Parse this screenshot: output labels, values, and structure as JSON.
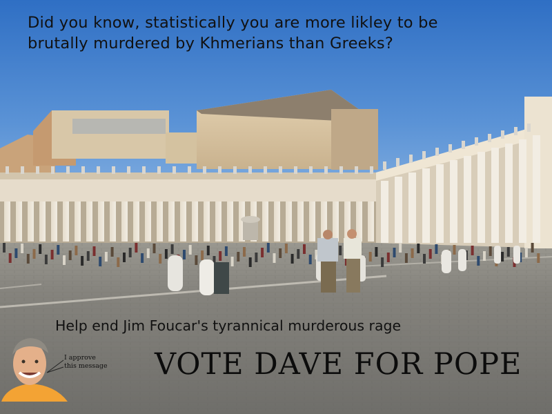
{
  "headline": {
    "line1": "Did you know, statistically you are more likley to be",
    "line2": "brutally murdered by Khmerians than Greeks?"
  },
  "subhead": "Help end Jim Foucar's tyrannical murderous rage",
  "vote_slogan": "VOTE DAVE FOR POPE",
  "approval": {
    "line1": "I approve",
    "line2": "this message"
  },
  "colors": {
    "sky": "#3a7acc",
    "pavement": "#7d7c78",
    "building": "#d9c5a3",
    "shirt": "#f3a334",
    "text": "#111111"
  }
}
